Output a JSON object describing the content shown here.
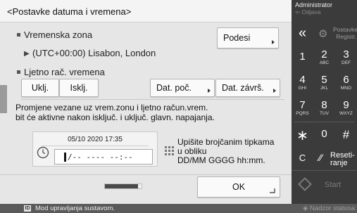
{
  "header": {
    "title": "<Postavke datuma i vremena>"
  },
  "time_zone": {
    "label": "Vremenska zona",
    "set_button": "Podesi",
    "value": "(UTC+00:00) Lisabon, London"
  },
  "dst": {
    "label": "Ljetno rač. vremena",
    "on_button": "Uklj.",
    "off_button": "Isklj.",
    "start_button": "Dat. poč.",
    "end_button": "Dat. závrš."
  },
  "note": "Promjene vezane uz vrem.zonu i ljetno račun.vrem.\nbit će aktivne nakon isključ. i uključ. glavn. napajanja.",
  "date_entry": {
    "current_value": "05/10 2020 17:35",
    "input_value": "/-- ---- --:--"
  },
  "hint": "Upišite brojčanim tipkama\nu obliku\nDD/MM GGGG hh:mm.",
  "footer": {
    "ok_button": "OK",
    "progress_fraction": 0.9
  },
  "status_bar": {
    "icon_text": "ID",
    "message": "Mod upravljanja sustavom.",
    "monitor": "Nadzor statusa"
  },
  "side_panel": {
    "user": "Administrator",
    "logout": "Odjava",
    "prefs": "Postavke/\nRegistr.",
    "keys": [
      {
        "digit": "1",
        "sub": ""
      },
      {
        "digit": "2",
        "sub": "ABC"
      },
      {
        "digit": "3",
        "sub": "DEF"
      },
      {
        "digit": "4",
        "sub": "GHI"
      },
      {
        "digit": "5",
        "sub": "JKL"
      },
      {
        "digit": "6",
        "sub": "MNO"
      },
      {
        "digit": "7",
        "sub": "PQRS"
      },
      {
        "digit": "8",
        "sub": "TUV"
      },
      {
        "digit": "9",
        "sub": "WXYZ"
      }
    ],
    "star": "∗",
    "zero": "0",
    "hash": "#",
    "clear": "C",
    "reset": "Reseti-\nranje",
    "start": "Start"
  },
  "icons": {
    "back": "double-chevron-left-icon",
    "prefs": "gear-icon",
    "reset": "slash-reset-icon",
    "start": "diamond-icon",
    "clock": "clock-icon",
    "keypad": "keypad-icon"
  }
}
